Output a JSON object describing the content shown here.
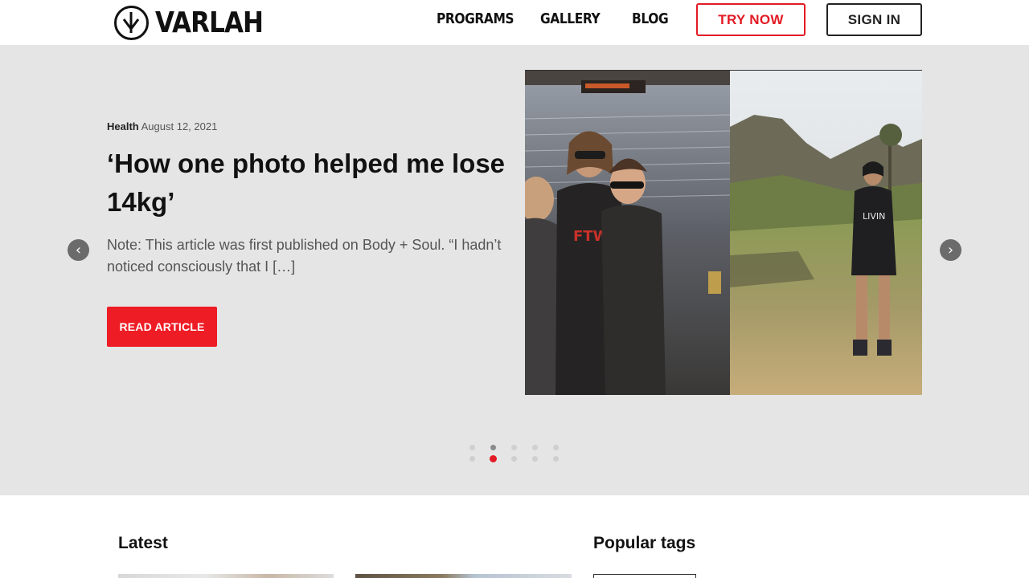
{
  "brand": {
    "name": "VARLAH"
  },
  "nav": {
    "links": [
      "PROGRAMS",
      "GALLERY",
      "BLOG"
    ],
    "try_label": "TRY NOW",
    "sign_in_label": "SIGN IN"
  },
  "hero": {
    "category": "Health",
    "date": "August 12, 2021",
    "title": "‘How one photo helped me lose 14kg’",
    "excerpt": "Note: This article was first published on Body + Soul. “I hadn’t noticed consciously that I […]",
    "cta_label": "READ ARTICLE",
    "prev_arrow": "‹",
    "next_arrow": "›",
    "image_shirt_text_1": "FTW.",
    "image_shirt_text_2": "LIVIN",
    "slider": {
      "total": 5,
      "active_index": 1
    }
  },
  "sections": {
    "latest_title": "Latest",
    "tags_title": "Popular tags"
  },
  "colors": {
    "accent": "#ee1c25",
    "hero_bg": "#e5e5e5",
    "text": "#111111"
  }
}
